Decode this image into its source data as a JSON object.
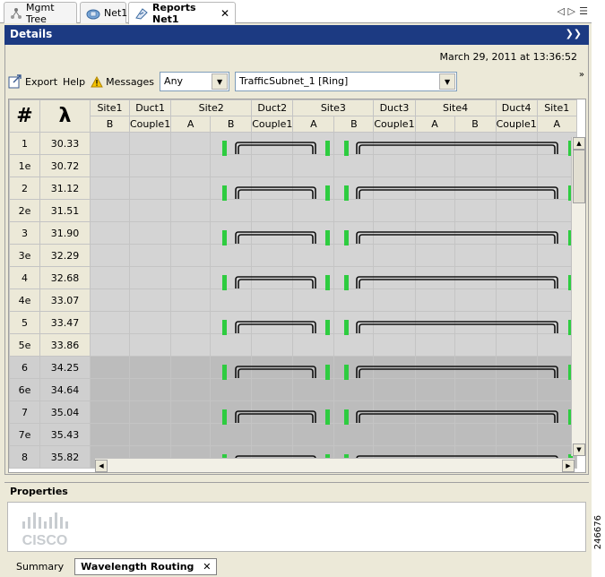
{
  "tabs": [
    {
      "label": "Mgmt Tree",
      "icon": "tree-icon",
      "active": false
    },
    {
      "label": "Net1",
      "icon": "network-icon",
      "active": false
    },
    {
      "label": "Reports Net1",
      "icon": "report-icon",
      "active": true
    }
  ],
  "details": {
    "title": "Details",
    "date": "March 29, 2011 at 13:36:52"
  },
  "toolbar": {
    "export_label": "Export",
    "help_label": "Help",
    "messages_label": "Messages",
    "filter_value": "Any",
    "subnet_value": "TrafficSubnet_1 [Ring]"
  },
  "grid": {
    "hash_header": "#",
    "lambda_header": "λ",
    "groups": [
      "Site1",
      "Duct1",
      "Site2",
      "Duct2",
      "Site3",
      "Duct3",
      "Site4",
      "Duct4",
      "Site1"
    ],
    "subheaders": [
      "B",
      "Couple1",
      "A",
      "B",
      "Couple1",
      "A",
      "B",
      "Couple1",
      "A",
      "B",
      "Couple1",
      "A"
    ],
    "rows": [
      {
        "id": "1",
        "wl": "30.33"
      },
      {
        "id": "1e",
        "wl": "30.72"
      },
      {
        "id": "2",
        "wl": "31.12"
      },
      {
        "id": "2e",
        "wl": "31.51"
      },
      {
        "id": "3",
        "wl": "31.90"
      },
      {
        "id": "3e",
        "wl": "32.29"
      },
      {
        "id": "4",
        "wl": "32.68"
      },
      {
        "id": "4e",
        "wl": "33.07"
      },
      {
        "id": "5",
        "wl": "33.47"
      },
      {
        "id": "5e",
        "wl": "33.86"
      },
      {
        "id": "6",
        "wl": "34.25"
      },
      {
        "id": "6e",
        "wl": "34.64"
      },
      {
        "id": "7",
        "wl": "35.04"
      },
      {
        "id": "7e",
        "wl": "35.43"
      },
      {
        "id": "8",
        "wl": "35.82"
      }
    ]
  },
  "properties": {
    "title": "Properties",
    "logo_text": "CISCO"
  },
  "bottom_tabs": [
    {
      "label": "Summary",
      "active": false
    },
    {
      "label": "Wavelength Routing",
      "active": true
    }
  ],
  "figure_id": "246676",
  "colors": {
    "header_blue": "#1c3a82",
    "route_green": "#2ecc40"
  }
}
